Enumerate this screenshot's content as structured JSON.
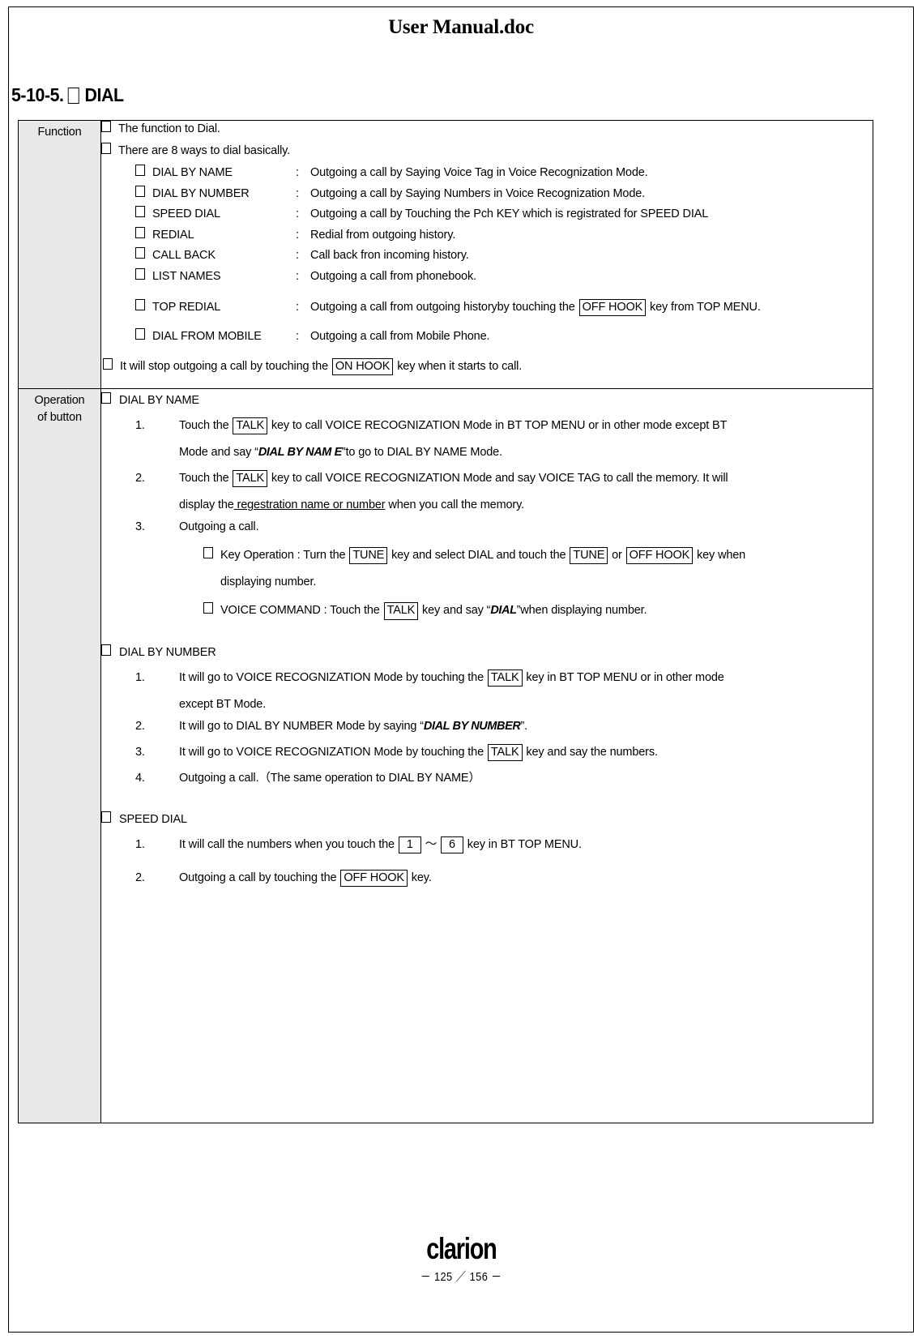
{
  "document": {
    "header_title": "User Manual.doc",
    "section_number": "5-10-5.",
    "section_title": "DIAL"
  },
  "table": {
    "rows": [
      {
        "label": "Function"
      },
      {
        "label_line1": "Operation",
        "label_line2": "of button"
      }
    ]
  },
  "function": {
    "intro_1": "The function to Dial.",
    "intro_2": "There are 8 ways to dial basically.",
    "methods": [
      {
        "name": "DIAL BY NAME",
        "colon": ":",
        "desc": "Outgoing a call by Saying Voice Tag in Voice Recognization Mode."
      },
      {
        "name": "DIAL BY NUMBER",
        "colon": ":",
        "desc": "Outgoing a call by Saying Numbers in Voice Recognization Mode."
      },
      {
        "name": "SPEED DIAL",
        "colon": ":",
        "desc": "Outgoing a call by Touching the Pch KEY which is registrated for SPEED DIAL"
      },
      {
        "name": "REDIAL",
        "colon": ":",
        "desc": "Redial from outgoing history."
      },
      {
        "name": "CALL BACK",
        "colon": ":",
        "desc": "Call back fron incoming history."
      },
      {
        "name": "LIST NAMES",
        "colon": ":",
        "desc": "Outgoing a call from phonebook."
      }
    ],
    "top_redial": {
      "name": "TOP REDIAL",
      "colon": ":",
      "desc_before": "Outgoing a call from outgoing historyby touching the",
      "key": "OFF HOOK",
      "desc_after": "key from TOP MENU."
    },
    "dial_from_mobile": {
      "name": "DIAL FROM MOBILE",
      "colon": ":",
      "desc": "Outgoing a call from Mobile Phone."
    },
    "stop_note": {
      "before": "It will stop outgoing a call by touching the",
      "key": "ON HOOK",
      "after": "key when it starts to call."
    }
  },
  "operation": {
    "dial_by_name": {
      "heading": "DIAL BY NAME",
      "step1": {
        "a": "Touch the",
        "key": "TALK",
        "b": "key to call VOICE RECOGNIZATION Mode in BT TOP MENU or in other mode except BT",
        "c_before": "Mode and say “",
        "c_emph": "DIAL BY NAM E",
        "c_after": "”to go to DIAL BY NAME Mode."
      },
      "step2": {
        "a": "Touch the",
        "key": "TALK",
        "b": "key to call VOICE RECOGNIZATION Mode and say VOICE TAG to call the memory. It will",
        "c_before": "display the",
        "c_underline": " regestration name or number",
        "c_after": " when you call the memory."
      },
      "step3": "Outgoing a call.",
      "sub_key_operation": {
        "name": "Key Operation",
        "colon": ":",
        "a": "Turn the",
        "key1": "TUNE",
        "b": "key and select DIAL and touch the",
        "key2": "TUNE",
        "c": "or",
        "key3": "OFF HOOK",
        "d": "key when",
        "e": "displaying number."
      },
      "sub_voice_command": {
        "name": "VOICE COMMAND",
        "colon": ":",
        "a": "Touch the",
        "key": "TALK",
        "b_before": "key and say “",
        "b_emph": "DIAL",
        "b_after": "”when displaying number."
      }
    },
    "dial_by_number": {
      "heading": "DIAL BY NUMBER",
      "step1": {
        "a": "It will go to VOICE RECOGNIZATION Mode by touching the",
        "key": "TALK",
        "b": "key in BT TOP MENU or in other mode",
        "c": "except BT Mode."
      },
      "step2": {
        "before": "It will go to DIAL BY NUMBER Mode by saying “",
        "emph": "DIAL BY NUMBER",
        "after": "”."
      },
      "step3": {
        "a": "It will go to VOICE RECOGNIZATION Mode by touching the",
        "key": "TALK",
        "b": "key and say the numbers."
      },
      "step4": "Outgoing a call.（The same operation to DIAL BY NAME）"
    },
    "speed_dial": {
      "heading": "SPEED DIAL",
      "step1": {
        "a": "It will call the numbers when you touch the",
        "key1": "1",
        "tilde": "～",
        "key2": "6",
        "b": "key in BT TOP MENU."
      },
      "step2": {
        "a": "Outgoing a call by touching the",
        "key": "OFF HOOK",
        "b": "key."
      }
    }
  },
  "footer": {
    "brand": "clarion",
    "page_label": "－ 125 ／ 156 －"
  }
}
